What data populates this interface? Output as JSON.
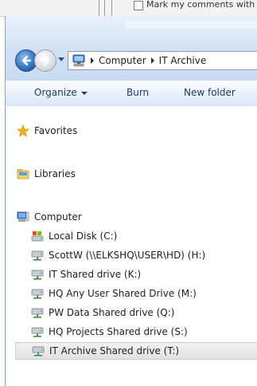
{
  "background_window": {
    "checkbox_label": "Mark my comments with"
  },
  "address": {
    "crumbs": [
      "Computer",
      "IT Archive"
    ]
  },
  "toolbar": {
    "organize": "Organize",
    "burn": "Burn",
    "new_folder": "New folder"
  },
  "nav": {
    "favorites": "Favorites",
    "libraries": "Libraries",
    "computer": "Computer",
    "drives": [
      {
        "label": "Local Disk (C:)",
        "icon": "local-disk-icon"
      },
      {
        "label": "ScottW (\\\\ELKSHQ\\USER\\HD) (H:)",
        "icon": "network-drive-icon"
      },
      {
        "label": "IT Shared drive (K:)",
        "icon": "network-drive-icon"
      },
      {
        "label": "HQ Any User Shared Drive (M:)",
        "icon": "network-drive-icon"
      },
      {
        "label": "PW Data Shared drive (Q:)",
        "icon": "network-drive-icon"
      },
      {
        "label": "HQ Projects Shared drive (S:)",
        "icon": "network-drive-icon"
      },
      {
        "label": "IT Archive Shared drive (T:)",
        "icon": "network-drive-icon"
      }
    ],
    "selected_drive": "IT Archive Shared drive (T:)"
  },
  "colors": {
    "toolbar_text": "#1e3a5f",
    "selection_bg": "#e6e6e6",
    "star": "#f2b21b"
  }
}
